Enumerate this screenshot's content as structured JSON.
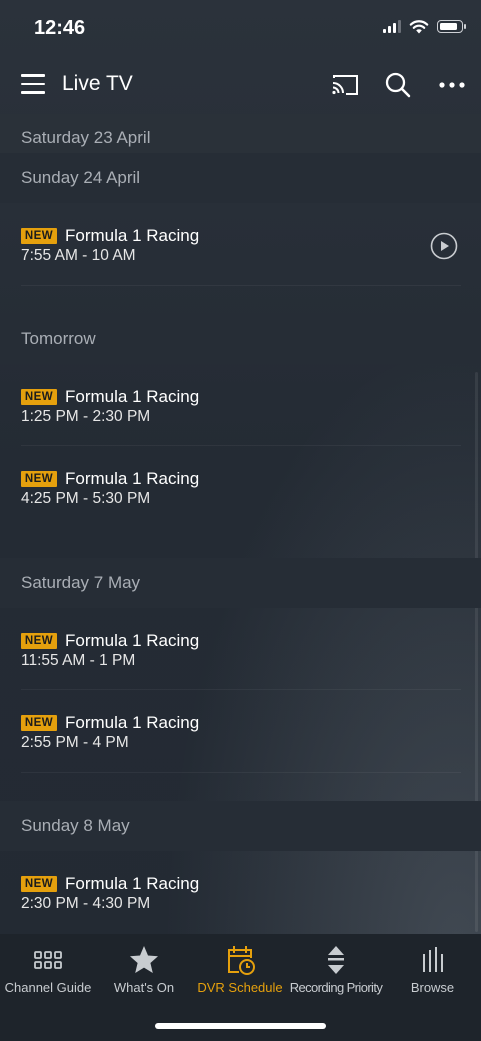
{
  "status_bar": {
    "time": "12:46"
  },
  "header": {
    "title": "Live TV"
  },
  "sections": [
    {
      "heading": "Saturday 23 April",
      "items": []
    },
    {
      "heading": "Sunday 24 April",
      "items": [
        {
          "badge": "NEW",
          "title": "Formula 1 Racing",
          "time": "7:55 AM - 10 AM",
          "playable": true
        }
      ]
    },
    {
      "heading": "Tomorrow",
      "items": [
        {
          "badge": "NEW",
          "title": "Formula 1 Racing",
          "time": "1:25 PM - 2:30 PM"
        },
        {
          "badge": "NEW",
          "title": "Formula 1 Racing",
          "time": "4:25 PM - 5:30 PM"
        }
      ]
    },
    {
      "heading": "Saturday 7 May",
      "items": [
        {
          "badge": "NEW",
          "title": "Formula 1 Racing",
          "time": "11:55 AM - 1 PM"
        },
        {
          "badge": "NEW",
          "title": "Formula 1 Racing",
          "time": "2:55 PM - 4 PM"
        }
      ]
    },
    {
      "heading": "Sunday 8 May",
      "items": [
        {
          "badge": "NEW",
          "title": "Formula 1 Racing",
          "time": "2:30 PM - 4:30 PM"
        }
      ]
    }
  ],
  "tabs": [
    {
      "label": "Channel Guide",
      "icon": "grid-icon",
      "active": false
    },
    {
      "label": "What's On",
      "icon": "star-icon",
      "active": false
    },
    {
      "label": "DVR Schedule",
      "icon": "calendar-clock-icon",
      "active": true
    },
    {
      "label": "Recording Priority",
      "icon": "sort-arrows-icon",
      "active": false
    },
    {
      "label": "Browse",
      "icon": "bars-icon",
      "active": false
    }
  ],
  "colors": {
    "accent": "#e5a00d",
    "background": "#232a33",
    "section": "#262d36"
  }
}
